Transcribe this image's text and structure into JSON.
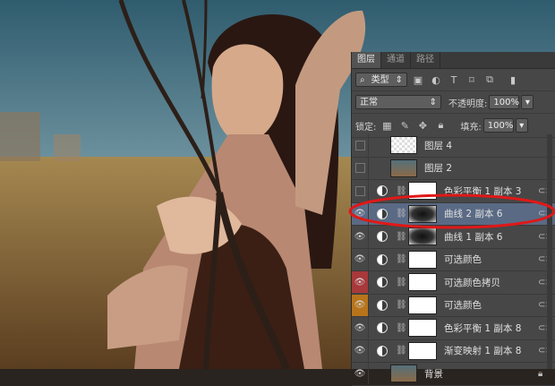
{
  "panel": {
    "tabs": [
      "图层",
      "通道",
      "路径"
    ],
    "filter_kind": "类型",
    "blend_mode": "正常",
    "opacity_label": "不透明度:",
    "opacity_value": "100%",
    "lock_label": "锁定:",
    "fill_label": "填充:",
    "fill_value": "100%"
  },
  "layers": [
    {
      "name": "图层 4",
      "kind": "image",
      "visible": false,
      "eye_color": ""
    },
    {
      "name": "图层 2",
      "kind": "image",
      "visible": false,
      "eye_color": ""
    },
    {
      "name": "色彩平衡 1 副本 3",
      "kind": "adjust",
      "visible": false,
      "eye_color": ""
    },
    {
      "name": "曲线 2 副本 6",
      "kind": "adjust",
      "visible": true,
      "eye_color": "",
      "selected": true,
      "mask": "dark"
    },
    {
      "name": "曲线 1 副本 6",
      "kind": "adjust",
      "visible": true,
      "eye_color": "",
      "mask": "dark"
    },
    {
      "name": "可选颜色",
      "kind": "adjust",
      "visible": true,
      "eye_color": ""
    },
    {
      "name": "可选颜色拷贝",
      "kind": "adjust",
      "visible": true,
      "eye_color": "#a8383a"
    },
    {
      "name": "可选颜色",
      "kind": "adjust",
      "visible": true,
      "eye_color": "#b8741b"
    },
    {
      "name": "色彩平衡 1 副本 8",
      "kind": "adjust",
      "visible": true,
      "eye_color": ""
    },
    {
      "name": "渐变映射 1 副本 8",
      "kind": "adjust",
      "visible": true,
      "eye_color": ""
    },
    {
      "name": "背景",
      "kind": "image",
      "visible": true,
      "eye_color": ""
    }
  ],
  "colors": {
    "selection": "#5a6a85",
    "annotation": "#e01818"
  }
}
